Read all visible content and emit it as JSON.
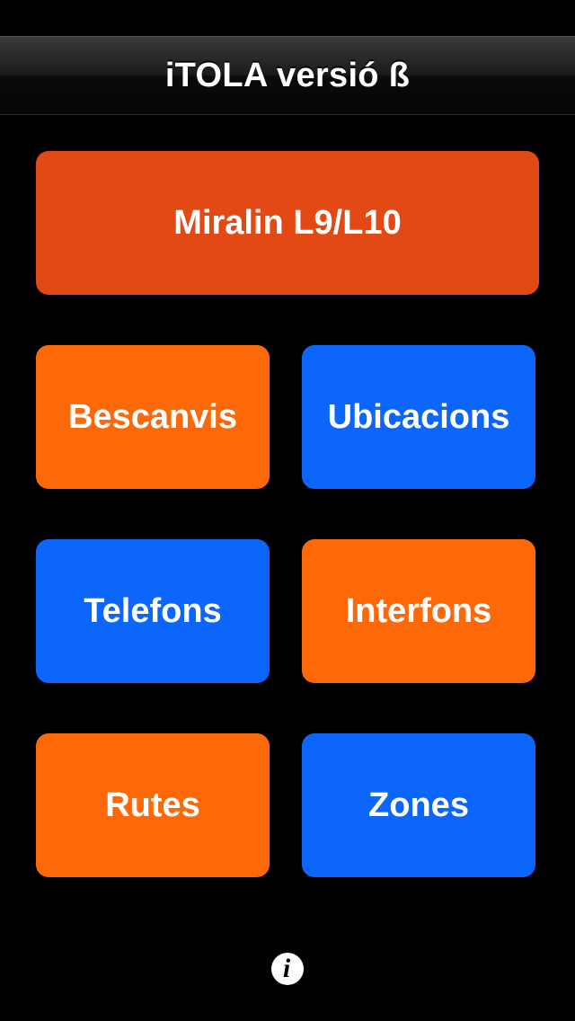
{
  "app": {
    "title": "iTOLA versió ß"
  },
  "menu": {
    "main": {
      "label": "Miralin L9/L10",
      "color": "#e24915"
    },
    "items": [
      {
        "label": "Bescanvis",
        "color": "#fd6909"
      },
      {
        "label": "Ubicacions",
        "color": "#0c66fc"
      },
      {
        "label": "Telefons",
        "color": "#0c66fc"
      },
      {
        "label": "Interfons",
        "color": "#fd6909"
      },
      {
        "label": "Rutes",
        "color": "#fd6909"
      },
      {
        "label": "Zones",
        "color": "#0c66fc"
      }
    ]
  },
  "footer": {
    "info_icon": "info-icon",
    "info_glyph": "i"
  },
  "colors": {
    "background": "#000000",
    "orange": "#fd6909",
    "blue": "#0c66fc",
    "red_orange": "#e24915"
  }
}
